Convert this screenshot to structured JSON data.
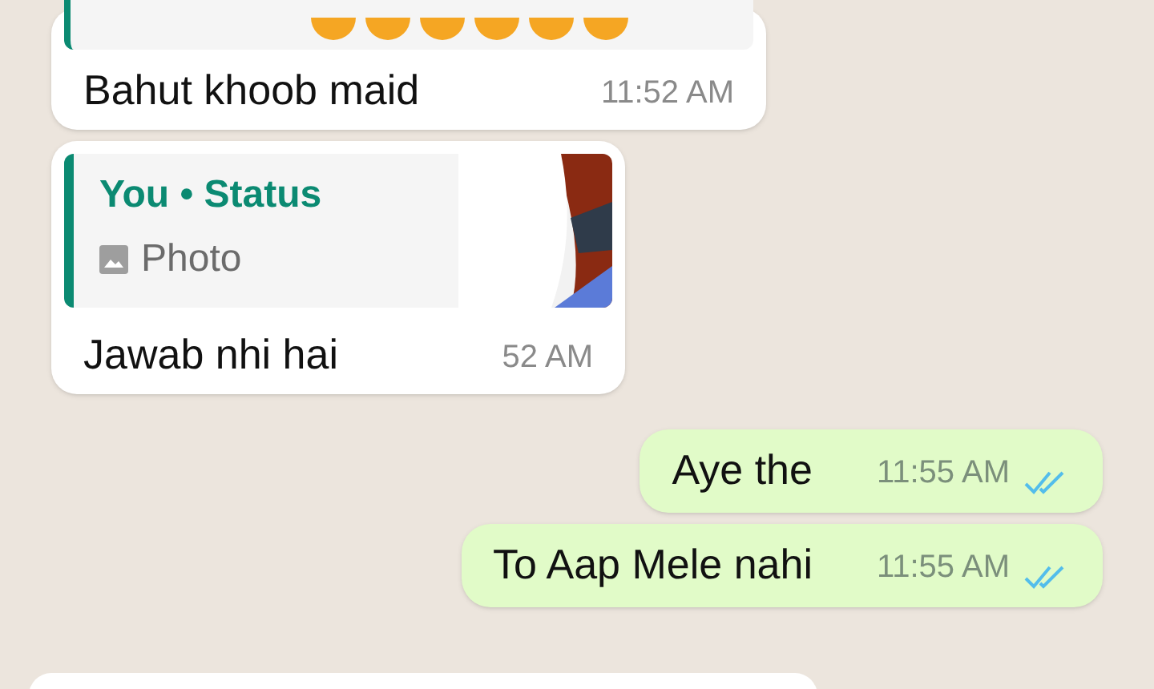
{
  "messages": [
    {
      "kind": "incoming",
      "quote": {
        "kind": "emoji"
      },
      "text": "Bahut khoob maid",
      "time": "11:52 AM"
    },
    {
      "kind": "incoming",
      "quote": {
        "kind": "status",
        "author": "You",
        "separator": "•",
        "source": "Status",
        "media": "Photo"
      },
      "text": "Jawab nhi hai",
      "time": "52 AM"
    },
    {
      "kind": "outgoing",
      "text": "Aye the",
      "time": "11:55 AM",
      "read": true
    },
    {
      "kind": "outgoing",
      "text": "To Aap Mele nahi",
      "time": "11:55 AM",
      "read": true
    }
  ]
}
